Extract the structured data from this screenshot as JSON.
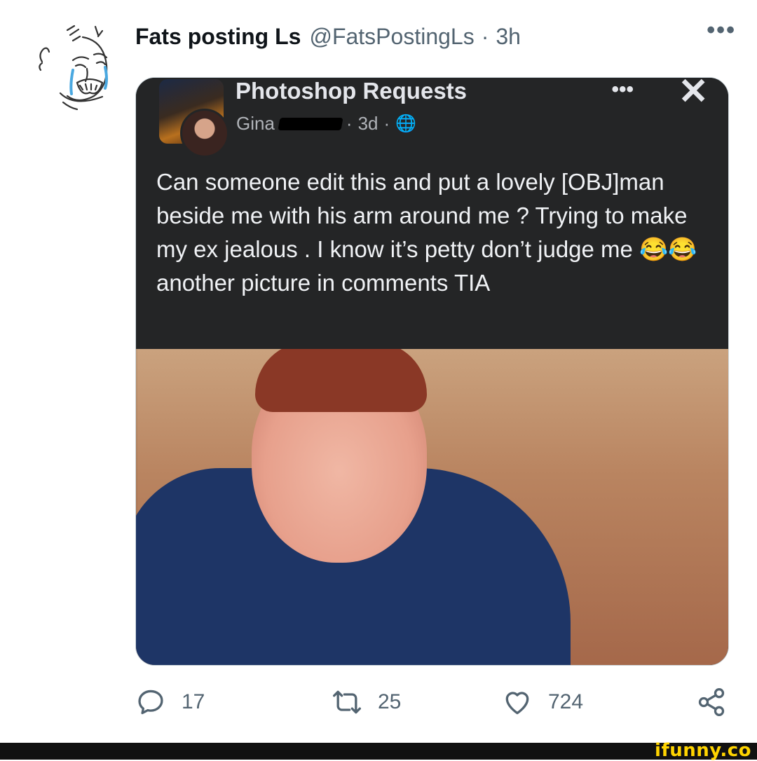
{
  "tweet": {
    "display_name": "Fats posting Ls",
    "handle": "@FatsPostingLs",
    "separator": "·",
    "time": "3h",
    "more_icon": "more-horizontal-icon"
  },
  "embedded_post": {
    "group_name": "Photoshop Requests",
    "author": "Gina",
    "meta_separator": "·",
    "age": "3d",
    "meta_separator_2": "·",
    "audience_icon": "globe-icon",
    "more_label": "•••",
    "close_label": "✕",
    "text": "Can someone edit this and put a lovely [OBJ]man beside me with his arm around me ? Trying to make my ex jealous . I know it’s petty don’t judge me 😂😂 another picture in comments TIA"
  },
  "engagement": {
    "replies": "17",
    "retweets": "25",
    "likes": "724",
    "reply_icon": "reply-icon",
    "retweet_icon": "retweet-icon",
    "like_icon": "heart-icon",
    "share_icon": "share-icon"
  },
  "footer": {
    "watermark": "ifunny.co"
  },
  "colors": {
    "text_primary": "#0f1419",
    "text_secondary": "#536471",
    "fb_background": "#242526",
    "watermark": "#ffd400"
  }
}
